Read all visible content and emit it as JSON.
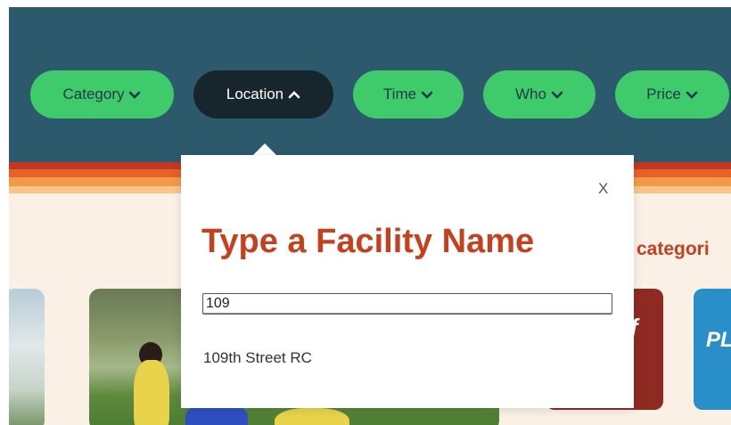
{
  "filters": [
    {
      "label": "Category",
      "active": false
    },
    {
      "label": "Location",
      "active": true
    },
    {
      "label": "Time",
      "active": false
    },
    {
      "label": "Who",
      "active": false
    },
    {
      "label": "Price",
      "active": false
    }
  ],
  "section": {
    "heading": "categori"
  },
  "popover": {
    "close_label": "X",
    "title": "Type a Facility Name",
    "input_value": "109",
    "results": [
      "109th Street RC"
    ]
  },
  "colors": {
    "header_bg": "#2c5a6c",
    "pill_green": "#3fca6b",
    "pill_active": "#17262c",
    "accent_red": "#c6401e"
  },
  "icons": {
    "chevron_down": "chevron-down-icon",
    "chevron_up": "chevron-up-icon"
  }
}
